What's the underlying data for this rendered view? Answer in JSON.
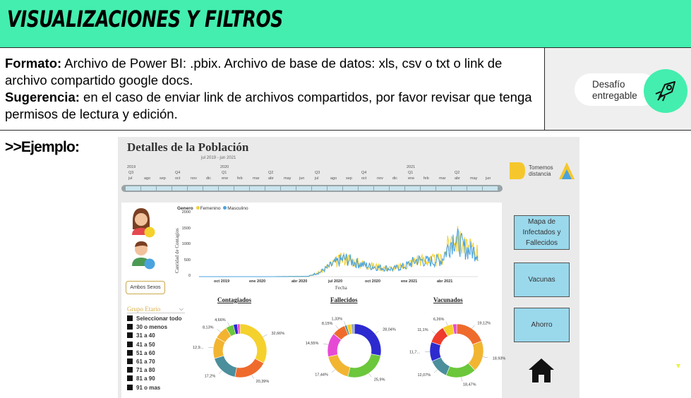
{
  "header": {
    "title": "VISUALIZACIONES Y FILTROS",
    "bg": "#43eeae"
  },
  "info": {
    "formato_label": "Formato:",
    "formato_text": " Archivo de Power BI: .pbix. Archivo de base de datos: xls, csv o txt o link de archivo compartido google docs.",
    "sugerencia_label": "Sugerencia:",
    "sugerencia_text": " en el caso de enviar link de archivos compartidos, por favor revisar que tenga permisos de lectura y edición."
  },
  "badge": {
    "line1": "Desafío",
    "line2": "entregable",
    "icon": "rocket-icon"
  },
  "ejemplo_label": ">>Ejemplo:",
  "dashboard": {
    "title": "Detalles de la Población",
    "subtitle": "jul 2019 - jun 2021",
    "timeline": {
      "years": [
        "2019",
        "2020",
        "2021"
      ],
      "quarters": [
        "Q3",
        "Q4",
        "Q1",
        "Q2",
        "Q3",
        "Q4",
        "Q1",
        "Q2"
      ],
      "months": [
        "jul",
        "ago",
        "sep",
        "oct",
        "nov",
        "dic",
        "ene",
        "feb",
        "mar",
        "abr",
        "may",
        "jun",
        "jul",
        "ago",
        "sep",
        "oct",
        "nov",
        "dic",
        "ene",
        "feb",
        "mar",
        "abr",
        "may",
        "jun"
      ]
    },
    "logo": {
      "line1": "Tomemos",
      "line2": "distancia"
    },
    "nav": [
      "Mapa de Infectados y Fallecidos",
      "Vacunas",
      "Ahorro"
    ],
    "home_icon": "home-icon",
    "avatars": [
      "female-avatar-icon",
      "male-avatar-icon"
    ],
    "ambos": "Ambos Sexos",
    "grupo_title": "Grupo Etario",
    "ages": [
      "Seleccionar todo",
      "30 o menos",
      "31 a 40",
      "41 a 50",
      "51 a 60",
      "61 a 70",
      "71 a 80",
      "81 a 90",
      "91 o mas"
    ],
    "legend": {
      "title": "Genero",
      "items": [
        "Femenino",
        "Masculino"
      ],
      "colors": [
        "#f2d23a",
        "#4aa3df"
      ]
    }
  },
  "chart_data": [
    {
      "type": "line",
      "legend_title": "Genero",
      "ylabel": "Cantidad de Contagios",
      "xlabel": "Fecha",
      "yticks": [
        "0",
        "500",
        "1000",
        "1500",
        "2000"
      ],
      "ylim": [
        0,
        2000
      ],
      "xticks": [
        "oct 2019",
        "ene 2020",
        "abr 2020",
        "jul 2020",
        "oct 2020",
        "ene 2021",
        "abr 2021"
      ],
      "series": [
        {
          "name": "Femenino",
          "color": "#f2d23a"
        },
        {
          "name": "Masculino",
          "color": "#4aa3df"
        }
      ],
      "x": [
        "2019-07",
        "2019-10",
        "2020-01",
        "2020-04",
        "2020-05",
        "2020-06",
        "2020-07",
        "2020-08",
        "2020-09",
        "2020-10",
        "2020-11",
        "2020-12",
        "2021-01",
        "2021-02",
        "2021-03",
        "2021-04",
        "2021-05",
        "2021-06"
      ],
      "values": [
        0,
        0,
        0,
        10,
        150,
        400,
        600,
        450,
        350,
        300,
        250,
        350,
        550,
        500,
        550,
        1300,
        900,
        800
      ]
    },
    {
      "type": "pie",
      "title": "Contagiados",
      "values": [
        32.66,
        20.39,
        17.2,
        12.9,
        8.13,
        4.66,
        2.5,
        1.56
      ],
      "labels": [
        "32,66%",
        "20,39%",
        "17,2%",
        "12,9...",
        "8,13%",
        "4,66%",
        "",
        ""
      ],
      "colors": [
        "#f5d12d",
        "#ef6b2c",
        "#4b8e9c",
        "#f2b531",
        "#f3b331",
        "#6cc73b",
        "#2d2ad0",
        "#e64ad4"
      ]
    },
    {
      "type": "pie",
      "title": "Fallecidos",
      "values": [
        28.04,
        25.9,
        17.44,
        14.55,
        8.15,
        1.33,
        2.59,
        2.0
      ],
      "labels": [
        "28,04%",
        "25,9%",
        "17,44%",
        "14,55%",
        "8,15%",
        "1,33%",
        "",
        ""
      ],
      "colors": [
        "#2d2ad0",
        "#6cc73b",
        "#f2b531",
        "#e64ad4",
        "#ef6b2c",
        "#4b8e9c",
        "#f5d12d",
        "#9ab"
      ]
    },
    {
      "type": "pie",
      "title": "Vacunados",
      "values": [
        19.12,
        18.93,
        18.47,
        12.07,
        11.7,
        11.1,
        6.26,
        2.35
      ],
      "labels": [
        "19,12%",
        "18,93%",
        "18,47%",
        "12,07%",
        "11,7...",
        "11,1%",
        "6,26%",
        ""
      ],
      "colors": [
        "#ef6b2c",
        "#f2b531",
        "#6cc73b",
        "#4b8e9c",
        "#2d2ad0",
        "#ef3b2c",
        "#f5d12d",
        "#e64ad4"
      ]
    }
  ]
}
